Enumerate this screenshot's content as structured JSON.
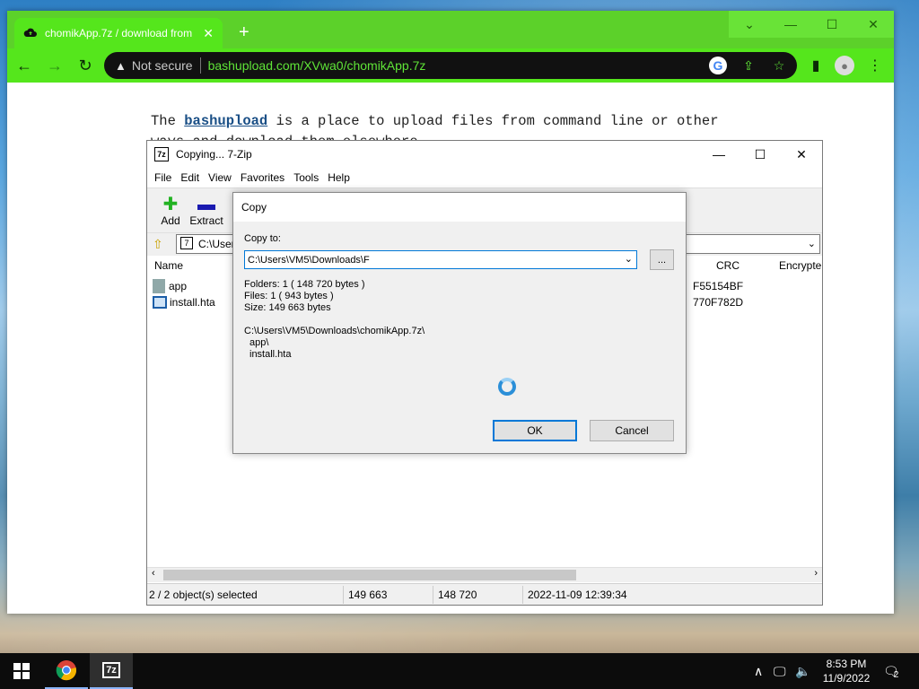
{
  "browser": {
    "tab_title": "chomikApp.7z / download from",
    "not_secure": "Not secure",
    "url_domain": "bashupload.com",
    "url_path": "/XVwa0/chomikApp.7z",
    "page_line1_pre": "The ",
    "page_link": "bashupload",
    "page_line1_post": " is a place to upload files from command line or other",
    "page_line2": "ways and download them elsewhere"
  },
  "zip": {
    "title": "Copying... 7-Zip",
    "menu": [
      "File",
      "Edit",
      "View",
      "Favorites",
      "Tools",
      "Help"
    ],
    "toolbar": {
      "add": "Add",
      "extract": "Extract"
    },
    "address": "C:\\Users",
    "columns": {
      "name": "Name",
      "crc": "CRC",
      "encrypted": "Encrypte"
    },
    "rows": [
      {
        "name": "app",
        "crc": "F55154BF"
      },
      {
        "name": "install.hta",
        "crc": "770F782D"
      }
    ],
    "status": {
      "selected": "2 / 2 object(s) selected",
      "size": "149 663",
      "packed": "148 720",
      "date": "2022-11-09 12:39:34"
    }
  },
  "dialog": {
    "title": "Copy",
    "copy_to_label": "Copy to:",
    "path": "C:\\Users\\VM5\\Downloads\\F",
    "browse": "...",
    "folders": "Folders: 1    ( 148 720 bytes )",
    "files": "Files: 1    ( 943 bytes )",
    "size": "Size: 149 663 bytes",
    "source": "C:\\Users\\VM5\\Downloads\\chomikApp.7z\\",
    "item1": "app\\",
    "item2": "install.hta",
    "ok": "OK",
    "cancel": "Cancel"
  },
  "taskbar": {
    "time": "8:53 PM",
    "date": "11/9/2022",
    "notifications": "2"
  }
}
